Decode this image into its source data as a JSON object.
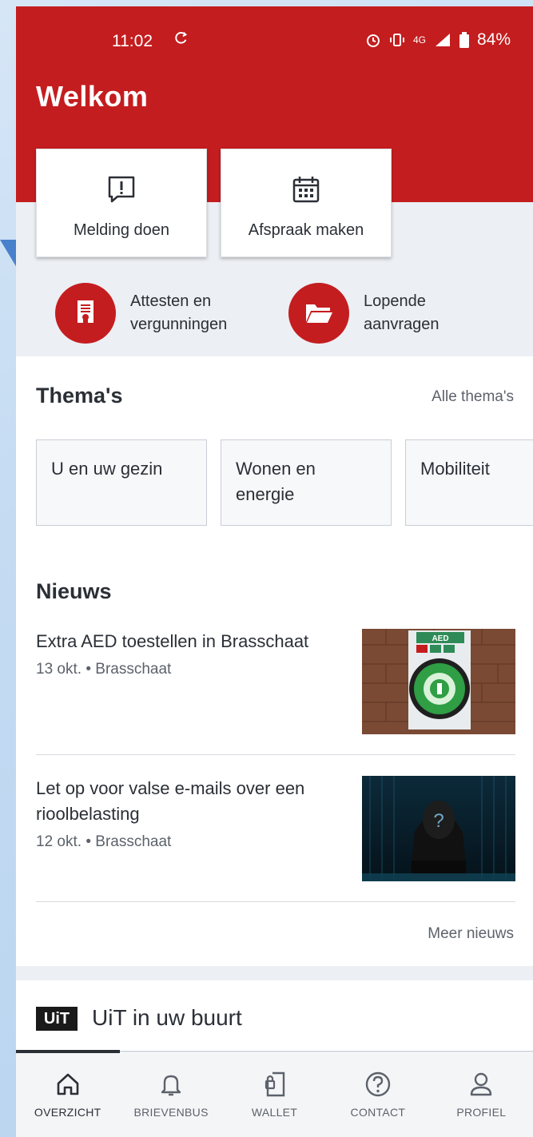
{
  "status_bar": {
    "time": "11:02",
    "network": "4G",
    "battery": "84%"
  },
  "header": {
    "title": "Welkom"
  },
  "quick_actions": [
    {
      "label": "Melding doen",
      "icon": "report-icon"
    },
    {
      "label": "Afspraak maken",
      "icon": "calendar-icon"
    }
  ],
  "quick_links": [
    {
      "label": "Attesten en vergunningen",
      "icon": "certificate-icon"
    },
    {
      "label": "Lopende aanvragen",
      "icon": "folder-icon"
    }
  ],
  "themes": {
    "title": "Thema's",
    "all_link": "Alle thema's",
    "items": [
      "U en uw gezin",
      "Wonen en energie",
      "Mobiliteit"
    ]
  },
  "news": {
    "title": "Nieuws",
    "more_link": "Meer nieuws",
    "items": [
      {
        "title": "Extra AED toestellen in Brasschaat",
        "date": "13 okt.",
        "location": "Brasschaat",
        "image": "aed-defibrillator-photo"
      },
      {
        "title": "Let op voor valse e-mails over een rioolbelasting",
        "date": "12 okt.",
        "location": "Brasschaat",
        "image": "hooded-hacker-photo"
      }
    ]
  },
  "uit": {
    "logo": "UiT",
    "title": "UiT in uw buurt"
  },
  "bottom_nav": [
    {
      "label": "OVERZICHT",
      "icon": "home-icon",
      "active": true
    },
    {
      "label": "BRIEVENBUS",
      "icon": "bell-icon",
      "active": false
    },
    {
      "label": "WALLET",
      "icon": "wallet-icon",
      "active": false
    },
    {
      "label": "CONTACT",
      "icon": "help-icon",
      "active": false
    },
    {
      "label": "PROFIEL",
      "icon": "profile-icon",
      "active": false
    }
  ],
  "colors": {
    "brand_red": "#c41d1f",
    "text": "#2b2f36",
    "muted": "#5c626b",
    "surface_grey": "#eceff3"
  }
}
